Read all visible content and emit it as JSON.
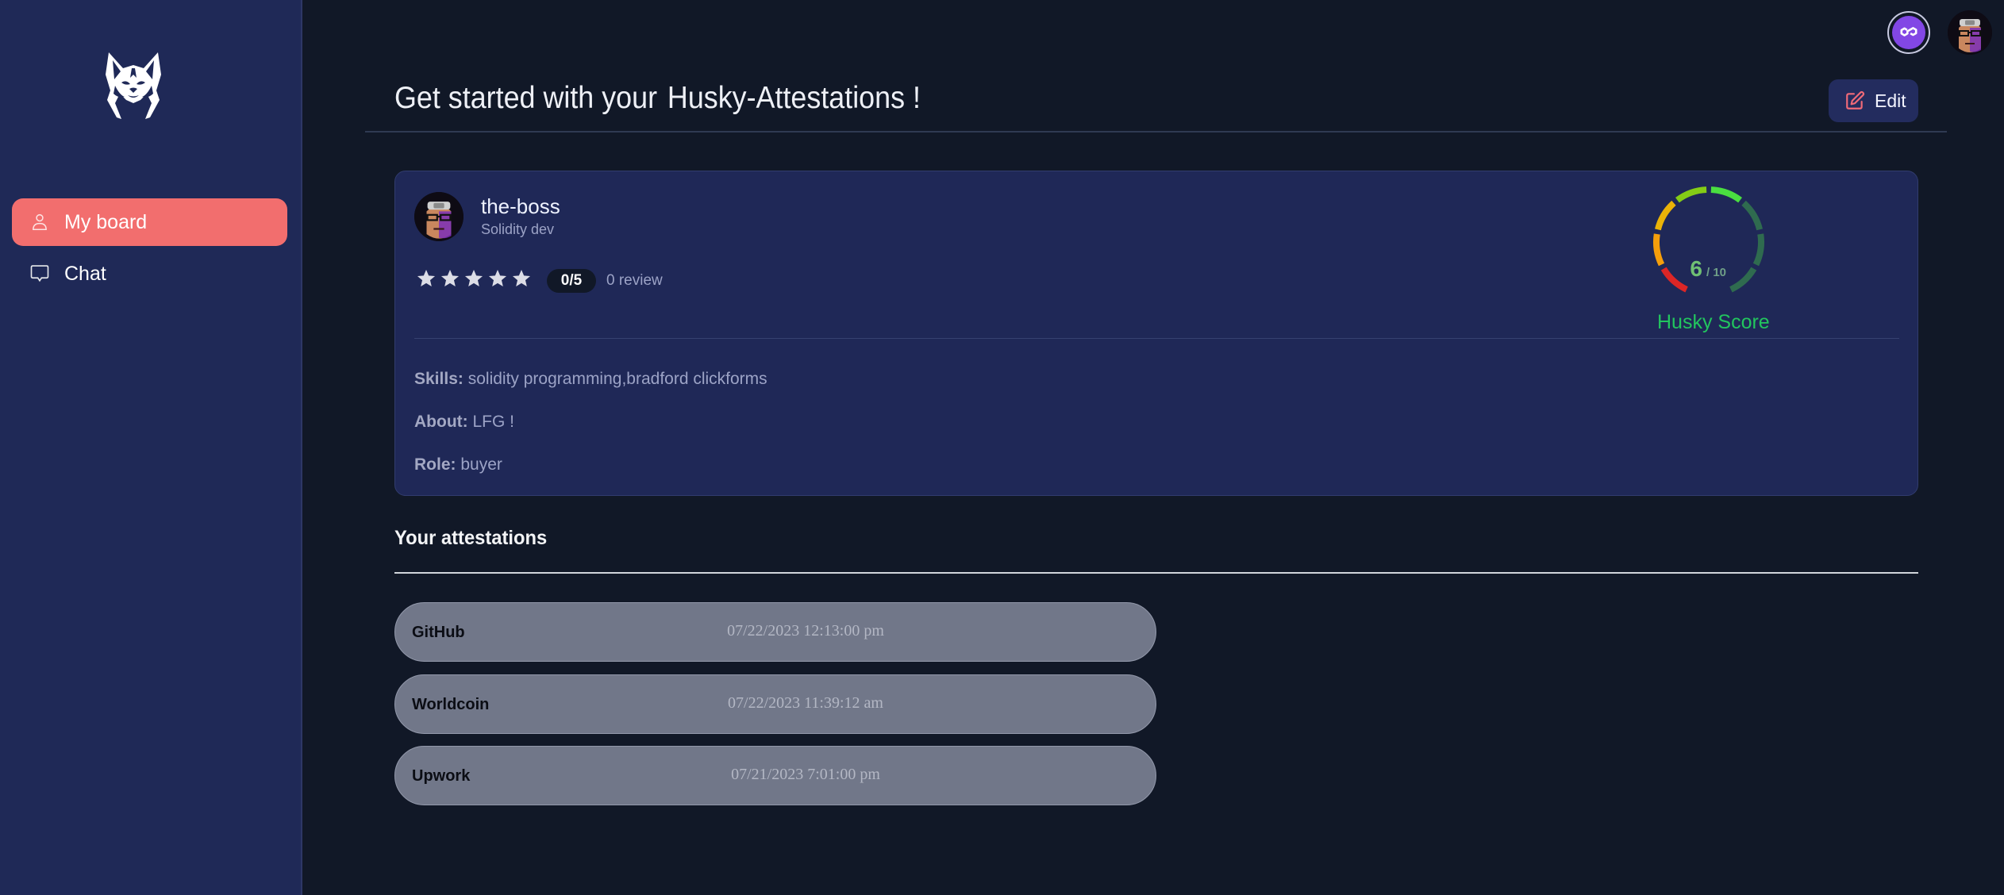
{
  "sidebar": {
    "logo_icon": "husky-logo",
    "items": [
      {
        "label": "My board",
        "icon": "user-icon",
        "active": true
      },
      {
        "label": "Chat",
        "icon": "chat-bubble-icon",
        "active": false
      }
    ]
  },
  "topbar": {
    "wallet_icon": "polygon-network-icon",
    "avatar_icon": "user-avatar"
  },
  "header": {
    "title_prefix": "Get started with your",
    "title_highlight": "Husky-Attestations !",
    "edit_label": "Edit"
  },
  "profile": {
    "name": "the-boss",
    "title": "Solidity dev",
    "rating": {
      "value": 0,
      "max": 5,
      "badge": "0/5",
      "review_text": "0 review"
    },
    "score": {
      "value": 6,
      "max": 10,
      "value_text": "6",
      "max_text": "/ 10",
      "label": "Husky Score",
      "active_segments": 5,
      "total_segments": 8,
      "segment_colors": [
        "#dc2626",
        "#f59e0b",
        "#eab308",
        "#84cc16",
        "#4ade40",
        "#2f6b4f",
        "#2f6b4f",
        "#2f6b4f"
      ],
      "label_color": "#22c55e"
    },
    "details": {
      "skills_label": "Skills:",
      "skills_value": "solidity programming,bradford clickforms",
      "about_label": "About:",
      "about_value": "LFG !",
      "role_label": "Role:",
      "role_value": "buyer"
    }
  },
  "attestations": {
    "title": "Your attestations",
    "items": [
      {
        "provider": "GitHub",
        "date": "07/22/2023 12:13:00 pm"
      },
      {
        "provider": "Worldcoin",
        "date": "07/22/2023 11:39:12 am"
      },
      {
        "provider": "Upwork",
        "date": "07/21/2023 7:01:00 pm"
      }
    ]
  },
  "colors": {
    "accent": "#f26e6e",
    "sidebar_bg": "#1f2957",
    "page_bg": "#111827",
    "card_bg": "#1f2857"
  }
}
